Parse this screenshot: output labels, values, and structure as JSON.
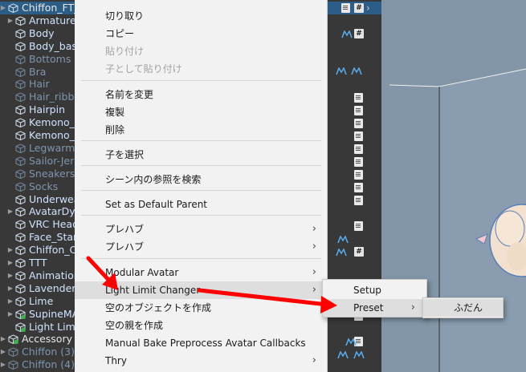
{
  "hierarchy": {
    "rows": [
      {
        "name": "Chiffon_FT_",
        "kind": "root",
        "selected": true,
        "arrow": true
      },
      {
        "name": "Armature",
        "kind": "active",
        "arrow": true
      },
      {
        "name": "Body",
        "kind": "active"
      },
      {
        "name": "Body_bas",
        "kind": "active"
      },
      {
        "name": "Bottoms",
        "kind": "inactive"
      },
      {
        "name": "Bra",
        "kind": "inactive"
      },
      {
        "name": "Hair",
        "kind": "inactive"
      },
      {
        "name": "Hair_ribbo",
        "kind": "inactive"
      },
      {
        "name": "Hairpin",
        "kind": "active"
      },
      {
        "name": "Kemono_",
        "kind": "active"
      },
      {
        "name": "Kemono_",
        "kind": "active"
      },
      {
        "name": "Legwarm",
        "kind": "inactive"
      },
      {
        "name": "Sailor-Jer",
        "kind": "inactive"
      },
      {
        "name": "Sneakers",
        "kind": "inactive"
      },
      {
        "name": "Socks",
        "kind": "inactive"
      },
      {
        "name": "Underwea",
        "kind": "active"
      },
      {
        "name": "AvatarDy",
        "kind": "active",
        "arrow": true
      },
      {
        "name": "VRC Head",
        "kind": "active"
      },
      {
        "name": "Face_Star",
        "kind": "active"
      },
      {
        "name": "Chiffon_C",
        "kind": "active",
        "arrow": true
      },
      {
        "name": "TTT",
        "kind": "active",
        "arrow": true
      },
      {
        "name": "Animation",
        "kind": "active",
        "arrow": true
      },
      {
        "name": "Lavender",
        "kind": "active",
        "arrow": true
      },
      {
        "name": "Lime",
        "kind": "active",
        "arrow": true
      },
      {
        "name": "SupineMA",
        "kind": "active",
        "arrow": true
      },
      {
        "name": "Light Lim",
        "kind": "active"
      },
      {
        "name": "Accessory",
        "kind": "root",
        "arrow": true
      },
      {
        "name": "Chiffon (3)",
        "kind": "inactive",
        "arrow": true
      },
      {
        "name": "Chiffon (4)",
        "kind": "inactive",
        "arrow": true
      }
    ]
  },
  "menu": {
    "items": [
      {
        "label": "切り取り",
        "disabled": false,
        "submenu": false
      },
      {
        "label": "コピー",
        "disabled": false,
        "submenu": false
      },
      {
        "label": "貼り付け",
        "disabled": true,
        "submenu": false
      },
      {
        "label": "子として貼り付け",
        "disabled": true,
        "submenu": false
      },
      {
        "label": "名前を変更",
        "disabled": false,
        "submenu": false
      },
      {
        "label": "複製",
        "disabled": false,
        "submenu": false
      },
      {
        "label": "削除",
        "disabled": false,
        "submenu": false
      },
      {
        "label": "子を選択",
        "disabled": false,
        "submenu": false
      },
      {
        "label": "シーン内の参照を検索",
        "disabled": false,
        "submenu": false
      },
      {
        "label": "Set as Default Parent",
        "disabled": false,
        "submenu": false
      },
      {
        "label": "プレハブ",
        "disabled": false,
        "submenu": true
      },
      {
        "label": "プレハブ",
        "disabled": false,
        "submenu": true
      },
      {
        "label": "Modular Avatar",
        "disabled": false,
        "submenu": true
      },
      {
        "label": "Light Limit Changer",
        "disabled": false,
        "submenu": true,
        "highlight": true
      },
      {
        "label": "空のオブジェクトを作成",
        "disabled": false,
        "submenu": false
      },
      {
        "label": "空の親を作成",
        "disabled": false,
        "submenu": false
      },
      {
        "label": "Manual Bake Preprocess Avatar Callbacks",
        "disabled": false,
        "submenu": false
      },
      {
        "label": "Thry",
        "disabled": false,
        "submenu": true
      }
    ]
  },
  "submenu_llc": {
    "items": [
      {
        "label": "Setup",
        "submenu": false
      },
      {
        "label": "Preset",
        "submenu": true,
        "highlight": true
      }
    ]
  },
  "submenu_preset": {
    "items": [
      {
        "label": "ふだん",
        "highlight": true
      }
    ]
  },
  "colors": {
    "selection": "#2c5d87",
    "arrow_annotation": "#ff0000",
    "menu_bg": "#f2f2f2",
    "scene_bg": "#8296a8"
  }
}
